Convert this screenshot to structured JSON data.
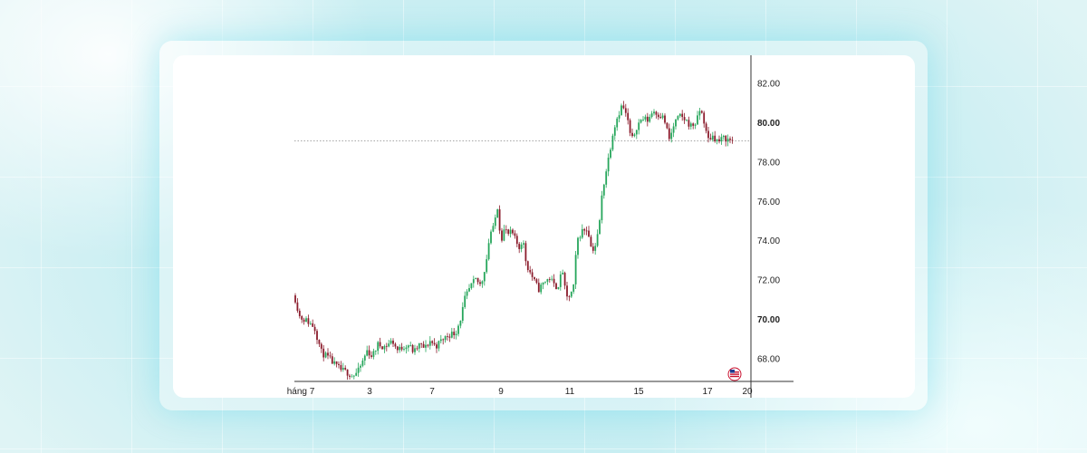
{
  "chart_data": {
    "type": "candlestick",
    "title": "",
    "xlabel": "",
    "ylabel": "",
    "ylim": [
      66.0,
      83.4
    ],
    "y_ticks": [
      "68.00",
      "70.00",
      "72.00",
      "74.00",
      "76.00",
      "78.00",
      "80.00",
      "82.00"
    ],
    "y_tick_values": [
      68,
      70,
      72,
      74,
      76,
      78,
      80,
      82
    ],
    "x_ticks": [
      "háng 7",
      "3",
      "7",
      "9",
      "11",
      "15",
      "17",
      "20"
    ],
    "current_price": 79.05,
    "legend": "none",
    "grid": false,
    "colors": {
      "up": "#26a65b",
      "down": "#8b1c2c",
      "axis": "#333333",
      "price_line": "#8a8a8a"
    },
    "flag_icon": "us-flag-icon",
    "close_path": [
      [
        0,
        71.2
      ],
      [
        6,
        70.1
      ],
      [
        14,
        69.9
      ],
      [
        22,
        69.6
      ],
      [
        30,
        68.3
      ],
      [
        38,
        68.0
      ],
      [
        46,
        67.6
      ],
      [
        52,
        67.4
      ],
      [
        58,
        67.3
      ],
      [
        64,
        67.1
      ],
      [
        70,
        67.3
      ],
      [
        76,
        67.9
      ],
      [
        80,
        68.4
      ],
      [
        86,
        68.1
      ],
      [
        92,
        68.7
      ],
      [
        100,
        68.6
      ],
      [
        108,
        68.9
      ],
      [
        114,
        68.4
      ],
      [
        120,
        68.6
      ],
      [
        126,
        68.7
      ],
      [
        132,
        68.3
      ],
      [
        138,
        68.7
      ],
      [
        144,
        68.5
      ],
      [
        150,
        68.9
      ],
      [
        156,
        68.6
      ],
      [
        162,
        68.9
      ],
      [
        170,
        69.2
      ],
      [
        178,
        69.3
      ],
      [
        184,
        70.1
      ],
      [
        188,
        71.0
      ],
      [
        194,
        71.6
      ],
      [
        200,
        72.0
      ],
      [
        206,
        71.7
      ],
      [
        212,
        73.0
      ],
      [
        216,
        74.4
      ],
      [
        220,
        74.6
      ],
      [
        224,
        75.8
      ],
      [
        228,
        74.0
      ],
      [
        232,
        74.6
      ],
      [
        236,
        74.3
      ],
      [
        240,
        74.4
      ],
      [
        244,
        74.0
      ],
      [
        248,
        73.6
      ],
      [
        252,
        74.1
      ],
      [
        256,
        72.8
      ],
      [
        262,
        72.2
      ],
      [
        266,
        71.8
      ],
      [
        270,
        71.5
      ],
      [
        276,
        71.9
      ],
      [
        282,
        72.1
      ],
      [
        288,
        71.6
      ],
      [
        292,
        71.8
      ],
      [
        296,
        72.5
      ],
      [
        300,
        71.0
      ],
      [
        304,
        71.2
      ],
      [
        308,
        71.5
      ],
      [
        312,
        74.0
      ],
      [
        318,
        74.5
      ],
      [
        324,
        74.6
      ],
      [
        328,
        73.5
      ],
      [
        332,
        73.7
      ],
      [
        336,
        74.5
      ],
      [
        340,
        76.5
      ],
      [
        344,
        77.5
      ],
      [
        348,
        78.5
      ],
      [
        352,
        79.6
      ],
      [
        356,
        80.2
      ],
      [
        362,
        80.9
      ],
      [
        368,
        80.1
      ],
      [
        372,
        79.0
      ],
      [
        378,
        79.8
      ],
      [
        384,
        80.2
      ],
      [
        390,
        80.1
      ],
      [
        396,
        80.6
      ],
      [
        402,
        80.4
      ],
      [
        408,
        80.2
      ],
      [
        414,
        79.1
      ],
      [
        420,
        80.0
      ],
      [
        426,
        80.3
      ],
      [
        432,
        80.1
      ],
      [
        438,
        79.8
      ],
      [
        444,
        80.0
      ],
      [
        448,
        80.7
      ],
      [
        452,
        80.1
      ],
      [
        456,
        79.1
      ],
      [
        462,
        79.3
      ],
      [
        468,
        79.0
      ],
      [
        474,
        79.2
      ],
      [
        480,
        79.1
      ],
      [
        484,
        79.1
      ]
    ]
  }
}
